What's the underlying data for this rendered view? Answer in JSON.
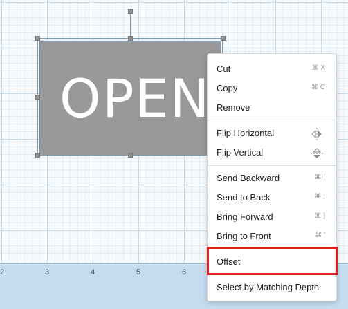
{
  "canvas": {
    "shape_text": "OPEN"
  },
  "ruler": {
    "ticks": [
      "2",
      "3",
      "4",
      "5",
      "6"
    ]
  },
  "context_menu": {
    "cut": {
      "label": "Cut",
      "shortcut": "⌘ X"
    },
    "copy": {
      "label": "Copy",
      "shortcut": "⌘ C"
    },
    "remove": {
      "label": "Remove"
    },
    "flip_horizontal": {
      "label": "Flip Horizontal",
      "icon": "flip-horizontal-icon"
    },
    "flip_vertical": {
      "label": "Flip Vertical",
      "icon": "flip-vertical-icon"
    },
    "send_backward": {
      "label": "Send Backward",
      "shortcut": "⌘ ["
    },
    "send_to_back": {
      "label": "Send to Back",
      "shortcut": "⌘ ;"
    },
    "bring_forward": {
      "label": "Bring Forward",
      "shortcut": "⌘ ]"
    },
    "bring_to_front": {
      "label": "Bring to Front",
      "shortcut": "⌘ '"
    },
    "offset": {
      "label": "Offset",
      "highlighted": true
    },
    "select_by_matching_depth": {
      "label": "Select by Matching Depth"
    }
  },
  "colors": {
    "highlight": "#e02020",
    "shape_fill": "#999999",
    "ruler": "#c5dcef"
  }
}
